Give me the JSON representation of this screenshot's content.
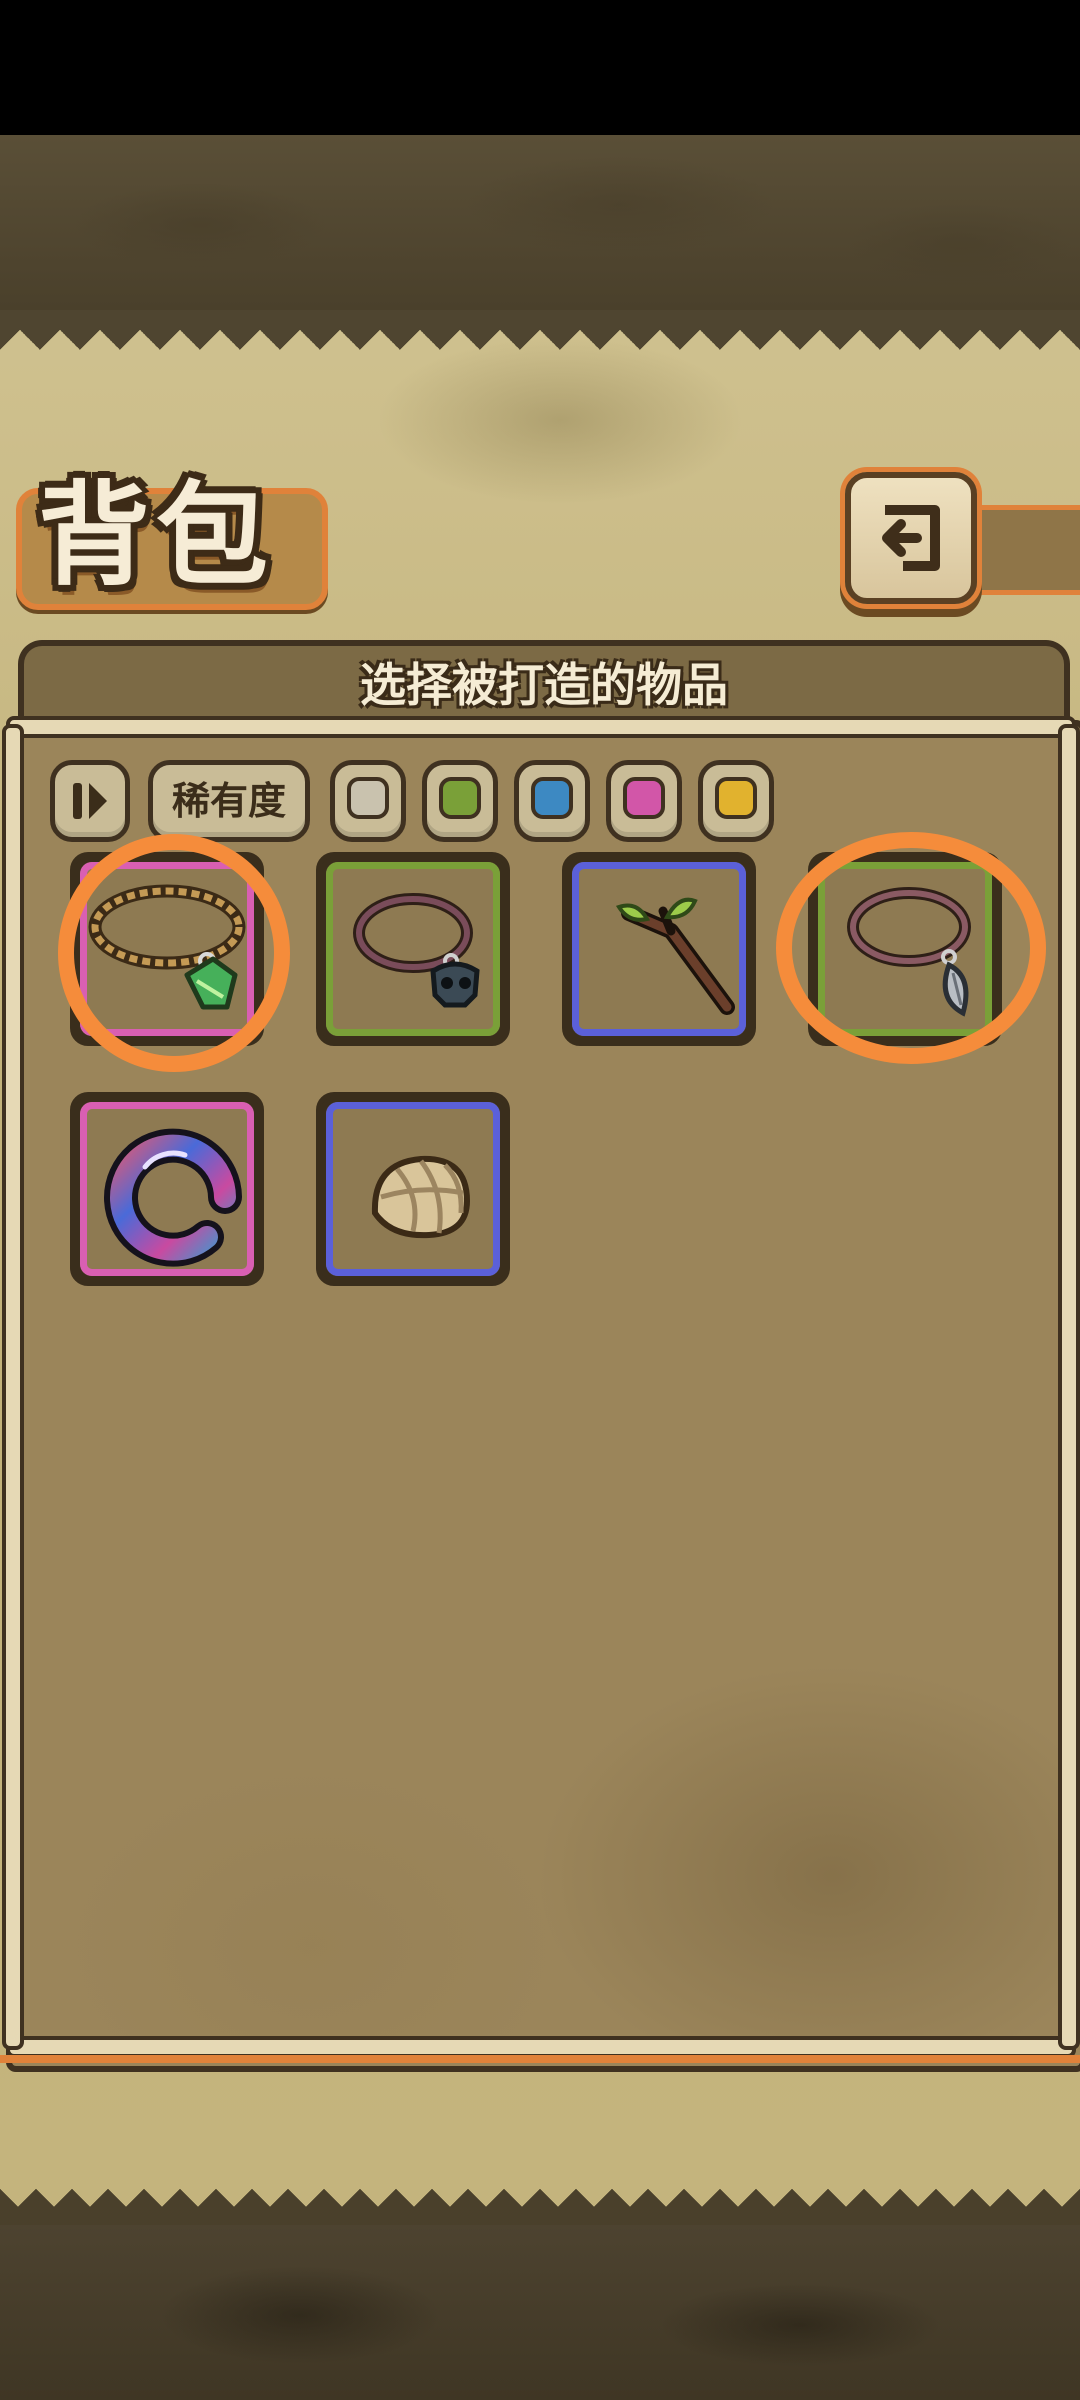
{
  "screen": {
    "title": "背包",
    "panel_title": "选择被打造的物品",
    "back_icon": "return-arrow-icon"
  },
  "filters": {
    "toggle_icon": "pause-toggle-icon",
    "rarity_label": "稀有度",
    "rarity_colors": [
      "#c9c2ae",
      "#7aa038",
      "#3d89c2",
      "#d256a8",
      "#e1b22e"
    ]
  },
  "items": [
    {
      "name": "leaf-vine-necklace",
      "rarity_color": "#d95fb2",
      "highlighted": true
    },
    {
      "name": "skull-pendant-necklace",
      "rarity_color": "#7aa038",
      "highlighted": false
    },
    {
      "name": "sprouting-twig",
      "rarity_color": "#5b60d9",
      "highlighted": false
    },
    {
      "name": "silver-leaf-necklace",
      "rarity_color": "#7aa038",
      "highlighted": true
    },
    {
      "name": "iridescent-ring",
      "rarity_color": "#d95fb2",
      "highlighted": false
    },
    {
      "name": "bandaged-shell",
      "rarity_color": "#5b60d9",
      "highlighted": false
    }
  ],
  "colors": {
    "highlight_circle": "#f58c3b",
    "panel_border_accent": "#e0823a"
  }
}
